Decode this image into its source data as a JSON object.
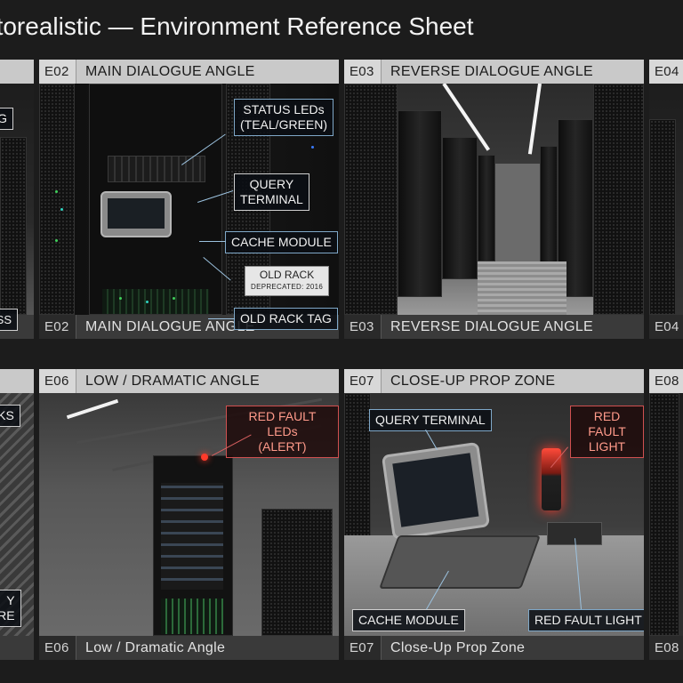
{
  "title": "otorealistic — Environment Reference Sheet",
  "colors": {
    "background": "#1c1c1c",
    "header_bar": "#c9c9c9",
    "footer_bar": "#3a3a3a",
    "callout_border": "#7fa8c8",
    "alert_red": "#d05050",
    "led_teal": "#2fd3c0",
    "led_green": "#3fcf5a"
  },
  "panels": {
    "p1": {
      "callouts": [
        "NG",
        "ESS"
      ]
    },
    "p2": {
      "code": "E02",
      "label": "MAIN DIALOGUE ANGLE",
      "footer_code": "E02",
      "footer_label": "MAIN DIALOGUE ANGLE",
      "callouts": {
        "status_leds": "STATUS LEDs\n(TEAL/GREEN)",
        "query_terminal": "QUERY\nTERMINAL",
        "cache_module": "CACHE MODULE",
        "old_rack_tag": "OLD RACK TAG"
      },
      "rack_tag": {
        "title": "OLD RACK",
        "sub": "DEPRECATED: 2016"
      }
    },
    "p3": {
      "code": "E03",
      "label": "REVERSE DIALOGUE ANGLE",
      "footer_code": "E03",
      "footer_label": "REVERSE DIALOGUE ANGLE"
    },
    "p4": {
      "code": "E04",
      "footer_code": "E04"
    },
    "p5": {
      "callouts": [
        "CKS",
        "Y\nURE"
      ]
    },
    "p6": {
      "code": "E06",
      "label": "LOW / DRAMATIC ANGLE",
      "footer_code": "E06",
      "footer_label": "Low / Dramatic Angle",
      "callouts": {
        "red_fault": "RED FAULT LEDs\n(ALERT)"
      }
    },
    "p7": {
      "code": "E07",
      "label": "CLOSE-UP PROP ZONE",
      "footer_code": "E07",
      "footer_label": "Close-Up Prop Zone",
      "callouts": {
        "query_terminal": "QUERY TERMINAL",
        "red_fault_light": "RED FAULT\nLIGHT",
        "cache_module": "CACHE MODULE",
        "red_fault_light_bottom": "RED FAULT LIGHT"
      }
    },
    "p8": {
      "code": "E08",
      "footer_code": "E08"
    }
  }
}
